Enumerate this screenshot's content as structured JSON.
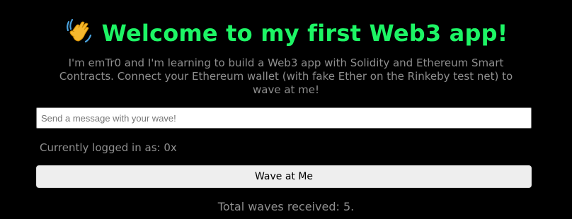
{
  "header": {
    "emoji": "👋",
    "title": "Welcome to my first Web3 app!",
    "title_color": "#1df565"
  },
  "bio": {
    "text": "I'm emTr0 and I'm learning to build a Web3 app with Solidity and Ethereum Smart Contracts. Connect your Ethereum wallet (with fake Ether on the Rinkeby test net) to wave at me!"
  },
  "message_input": {
    "value": "",
    "placeholder": "Send a message with your wave!"
  },
  "account": {
    "logged_in_text": "Currently logged in as: 0x"
  },
  "wave_button": {
    "label": "Wave at Me"
  },
  "stats": {
    "total_waves_text": "Total waves received: 5."
  },
  "colors": {
    "background": "#000000",
    "accent": "#1df565",
    "muted_text": "#8f8f8f"
  },
  "icons": {
    "header_icon": "waving-hand-icon"
  }
}
